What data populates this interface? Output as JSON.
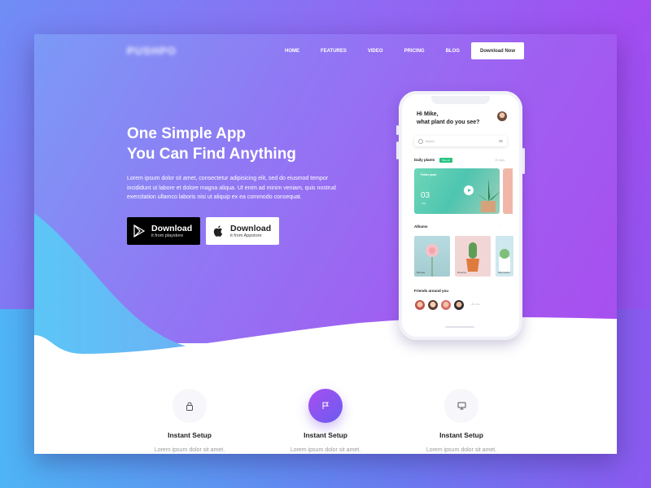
{
  "header": {
    "logo": "PUSHPO",
    "nav": [
      "HOME",
      "FEATURES",
      "VIDEO",
      "PRICING",
      "BLOG"
    ],
    "download_button": "Download Now"
  },
  "hero": {
    "title_line1": "One Simple App",
    "title_line2": "You Can Find Anything",
    "description": "Lorem ipsum dolor sit amet, consectetur adipisicing elit, sed do eiusmod tempor incididunt ut labore et dolore magna aliqua. Ut  enim ad minim veniam, quis nostrud exercitation ullamco laboris nisi ut aliquip ex ea commodo consequat.",
    "playstore": {
      "label": "Download",
      "sub": "it from playstore"
    },
    "appstore": {
      "label": "Download",
      "sub": "it from Appstore"
    }
  },
  "phone": {
    "greeting_line1": "Hi Mike,",
    "greeting_line2": "what plant do you see?",
    "search_placeholder": "Search",
    "daily_plants": "Daily plants",
    "daily_badge": "Play all",
    "daily_more": "25 days",
    "card_label": "Potter plant",
    "card_day": "03",
    "card_month": "July",
    "albums": "Albums",
    "albums_more": "...",
    "album_tags": [
      "#Flower",
      "#Cactus",
      "#Succulent"
    ],
    "friends": "Friends around you",
    "friends_more": "+8k other"
  },
  "features": [
    {
      "title": "Instant Setup",
      "desc": "Lorem ipsum dolor sit amet.",
      "icon": "lock-icon"
    },
    {
      "title": "Instant Setup",
      "desc": "Lorem ipsum dolor sit amet.",
      "icon": "flag-icon"
    },
    {
      "title": "Instant Setup",
      "desc": "Lorem ipsum dolor sit amet.",
      "icon": "monitor-icon"
    }
  ],
  "colors": {
    "accent_purple": "#a84ef0",
    "accent_blue": "#6f8df5",
    "badge_green": "#26c281"
  }
}
